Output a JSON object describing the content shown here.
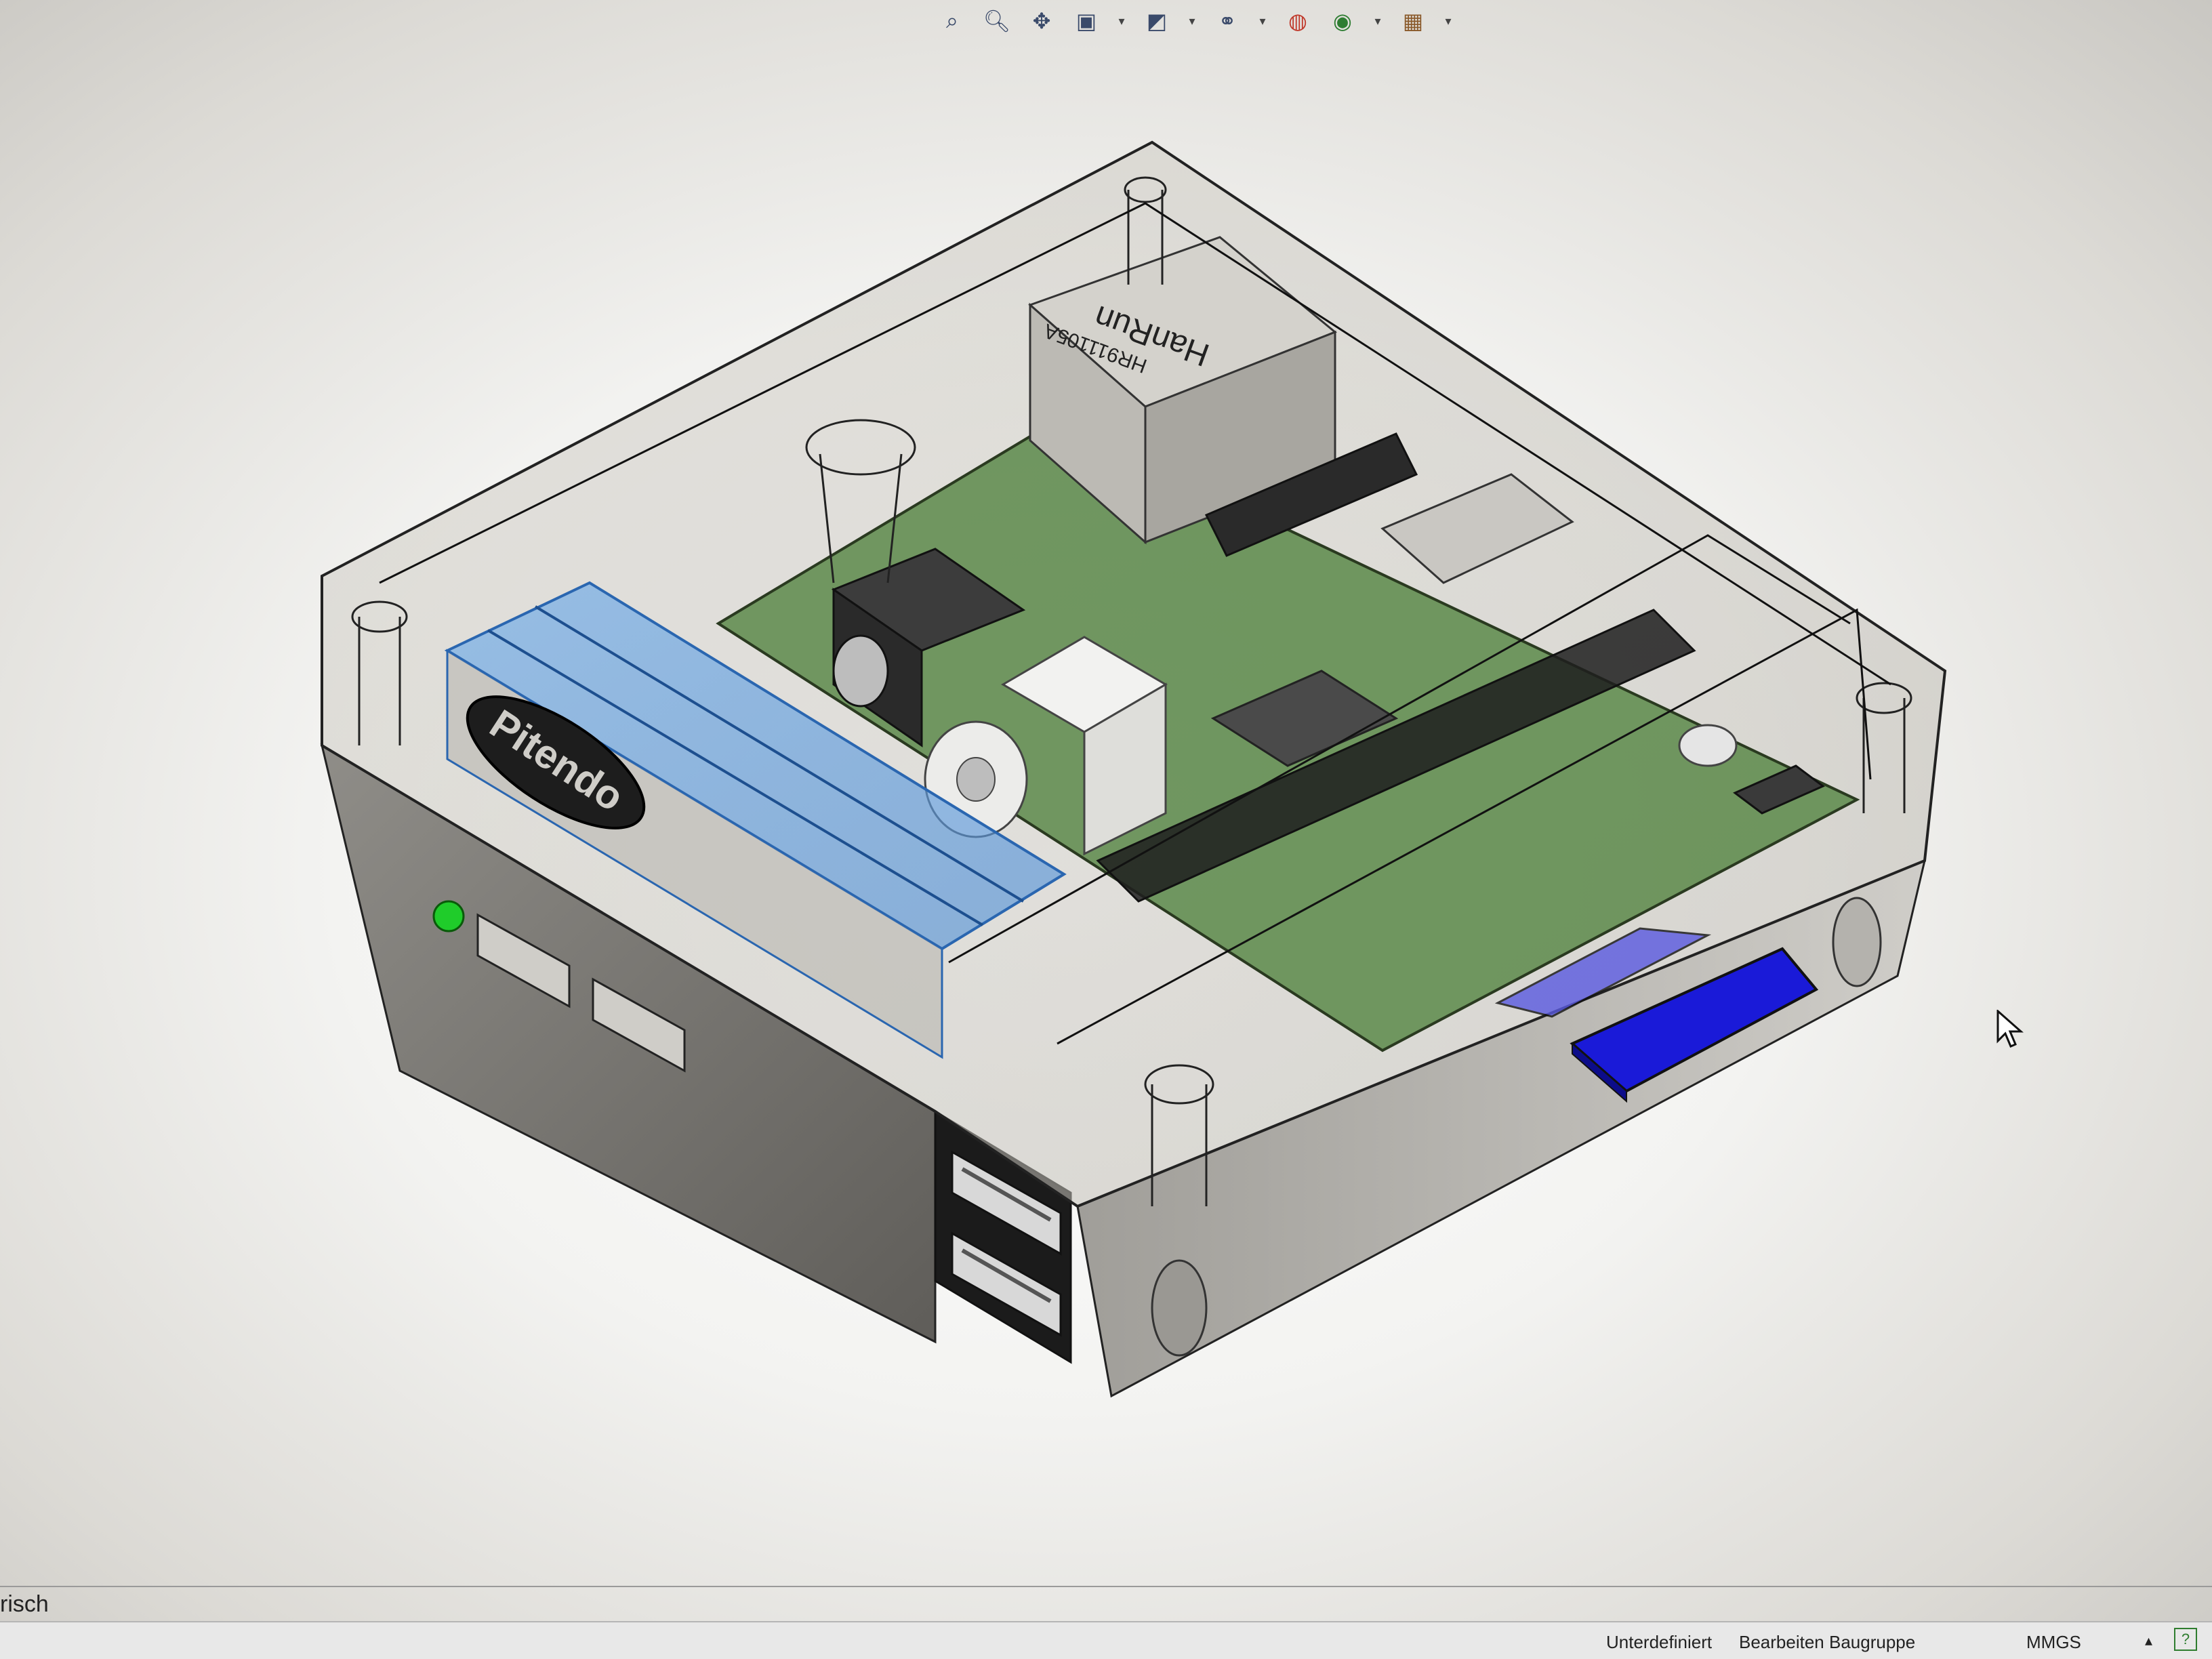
{
  "toolbar": {
    "icons": [
      "zoom-to-fit-icon",
      "zoom-area-icon",
      "pan-icon",
      "section-view-icon",
      "view-orientation-icon",
      "display-style-icon",
      "hide-show-icon",
      "appearance-icon",
      "scene-icon",
      "view-settings-icon"
    ]
  },
  "model": {
    "lid_logo": "Pitendo",
    "jack_label": "HanRun",
    "jack_code": "HR911105A"
  },
  "status": {
    "left_fragment": "risch",
    "definition_state": "Unterdefiniert",
    "mode": "Bearbeiten Baugruppe",
    "units": "MMGS",
    "units_arrow": "▴",
    "help": "?"
  },
  "colors": {
    "selection_blue": "#4f8fd6",
    "sd_card": "#1a1ad8",
    "pcb_green": "#5c8a4a",
    "led_green": "#1fcc2a",
    "case_gray": "#8d8b86"
  }
}
